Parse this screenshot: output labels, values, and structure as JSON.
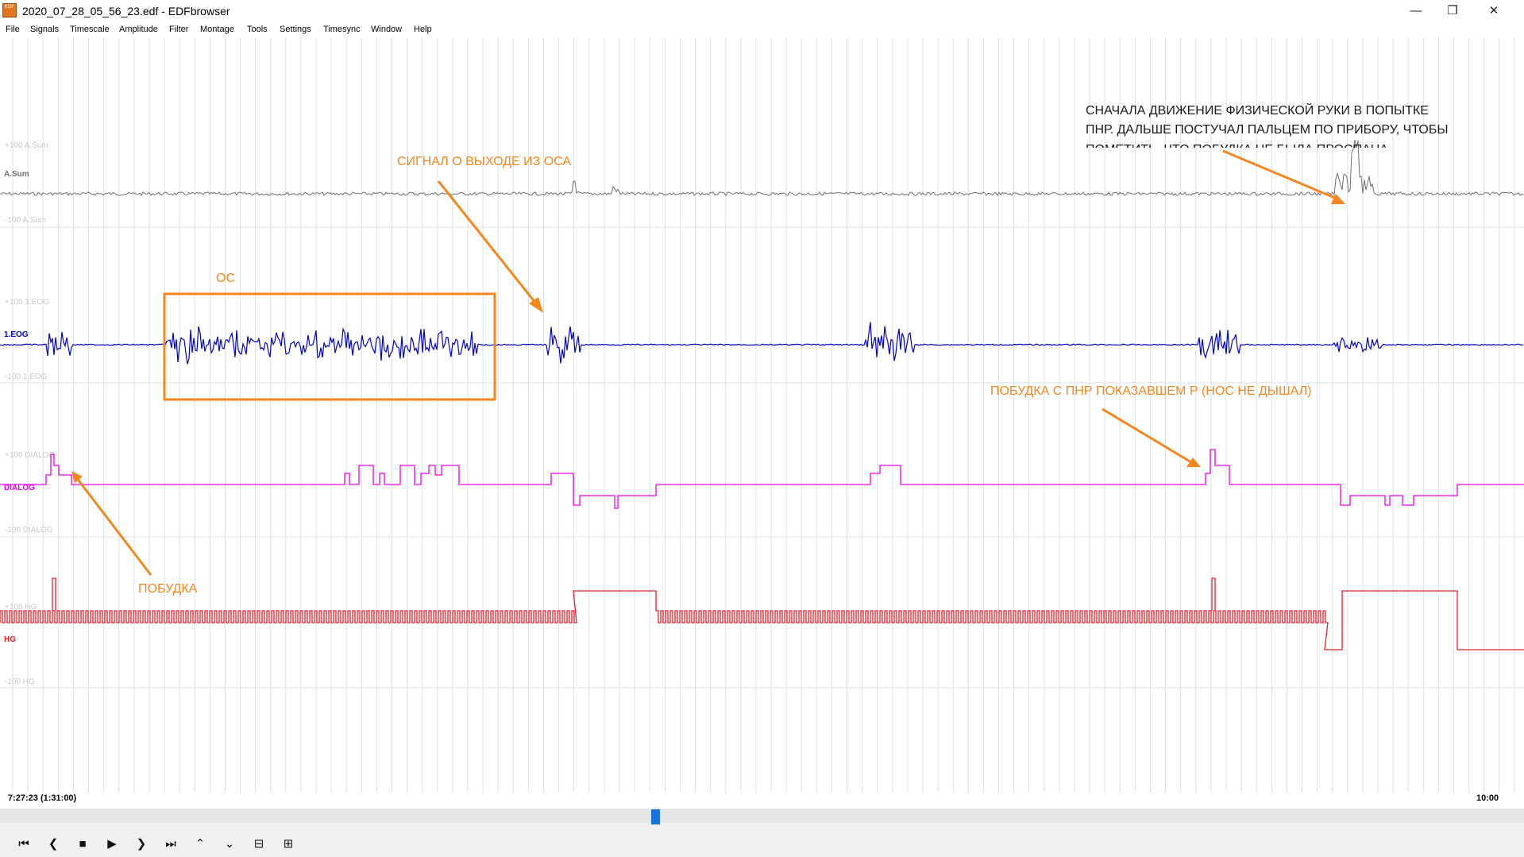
{
  "window": {
    "title": "2020_07_28_05_56_23.edf - EDFbrowser",
    "icon_name": "edf-app-icon",
    "controls": [
      "minimize-icon",
      "restore-icon",
      "close-icon"
    ]
  },
  "menu": [
    "File",
    "Signals",
    "Timescale",
    "Amplitude",
    "Filter",
    "Montage",
    "Tools",
    "Settings",
    "Timesync",
    "Window",
    "Help"
  ],
  "signals": [
    {
      "name": "A.Sum",
      "label": "A.Sum",
      "top": "+100 A.Sum",
      "bottom": "-100 A.Sum",
      "color": "#6f6f6f"
    },
    {
      "name": "1.EOG",
      "label": "1.EOG",
      "top": "+100 1.EOG",
      "bottom": "-100 1.EOG",
      "color": "#0000cc"
    },
    {
      "name": "DIALOG",
      "label": "DIALOG",
      "top": "+100 DIALOG",
      "bottom": "-100 DIALOG",
      "color": "#ee00ee"
    },
    {
      "name": "HG",
      "label": "HG",
      "top": "+100 HG",
      "bottom": "-100 HG",
      "color": "#e8202a"
    }
  ],
  "annotations": {
    "os_signal": "СИГНАЛ О ВЫХОДЕ ИЗ ОСА",
    "os": "ОС",
    "wakeup": "ПОБУДКА",
    "wakeup_pnr": "ПОБУДКА С ПНР ПОКАЗАВШЕМ  Р (НОС НЕ ДЫШАЛ)",
    "note_line1": "СНАЧАЛА ДВИЖЕНИЕ ФИЗИЧЕСКОЙ РУКИ В ПОПЫТКЕ",
    "note_line2": "ПНР. ДАЛЬШЕ ПОСТУЧАЛ ПАЛЬЦЕМ ПО ПРИБОРУ, ЧТОБЫ",
    "note_line3": "ПОМЕТИТЬ, ЧТО ПОБУДКА НЕ БЫЛА ПРОСПАНА",
    "color": "#f5861f"
  },
  "timeline": {
    "start": "7:27:23 (1:31:00)",
    "end": "10:00",
    "scroll_position": 0.43
  },
  "controls": [
    "skip-start-icon",
    "step-back-icon",
    "stop-icon",
    "play-icon",
    "step-forward-icon",
    "skip-end-icon",
    "amplitude-up-icon",
    "amplitude-down-icon",
    "zoom-out-icon",
    "zoom-in-icon"
  ]
}
